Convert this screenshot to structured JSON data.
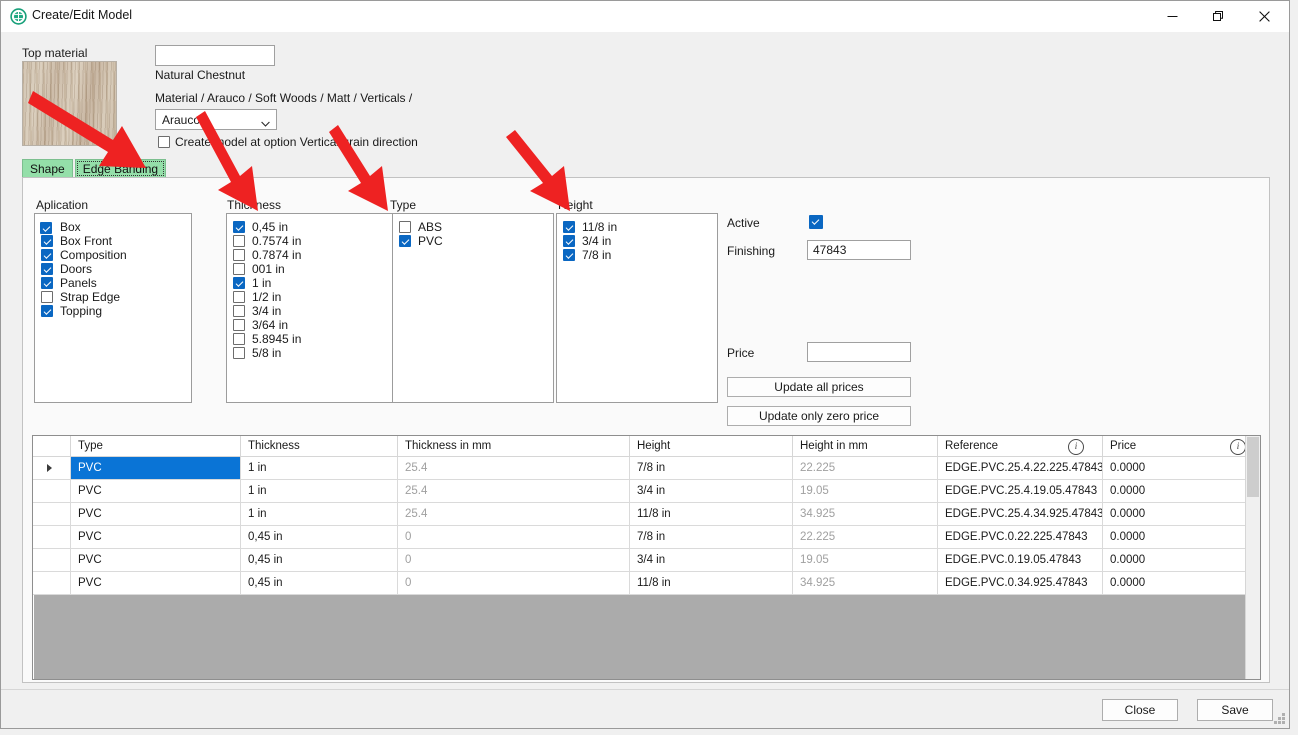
{
  "window": {
    "title": "Create/Edit Model",
    "icon": "globe-icon",
    "minimize": "−",
    "maximize": "❐",
    "close": "✕"
  },
  "top_form": {
    "top_material_label": "Top material",
    "material_name_value": "",
    "material_name_placeholder": "",
    "material_caption": "Natural Chestnut",
    "material_path": "Material  / Arauco / Soft Woods / Matt / Verticals /",
    "brand_combo_value": "Arauco",
    "vertical_grain_checkbox_label": "Create model at option Vertical grain direction",
    "vertical_grain_checked": false
  },
  "tabs": [
    {
      "label": "Shape",
      "active": false,
      "focused": false
    },
    {
      "label": "Edge Banding",
      "active": true,
      "focused": true
    }
  ],
  "lists": {
    "aplication": {
      "title": "Aplication",
      "items": [
        {
          "label": "Box",
          "checked": true
        },
        {
          "label": "Box Front",
          "checked": true
        },
        {
          "label": "Composition",
          "checked": true
        },
        {
          "label": "Doors",
          "checked": true
        },
        {
          "label": "Panels",
          "checked": true
        },
        {
          "label": "Strap Edge",
          "checked": false
        },
        {
          "label": "Topping",
          "checked": true
        }
      ]
    },
    "thickness": {
      "title": "Thickness",
      "items": [
        {
          "label": "0,45 in",
          "checked": true
        },
        {
          "label": "0.7574 in",
          "checked": false
        },
        {
          "label": "0.7874 in",
          "checked": false
        },
        {
          "label": "001 in",
          "checked": false
        },
        {
          "label": "1 in",
          "checked": true
        },
        {
          "label": "1/2 in",
          "checked": false
        },
        {
          "label": "3/4 in",
          "checked": false
        },
        {
          "label": "3/64 in",
          "checked": false
        },
        {
          "label": "5.8945 in",
          "checked": false
        },
        {
          "label": "5/8 in",
          "checked": false
        }
      ]
    },
    "type": {
      "title": "Type",
      "items": [
        {
          "label": "ABS",
          "checked": false
        },
        {
          "label": "PVC",
          "checked": true
        }
      ]
    },
    "height": {
      "title": "Height",
      "items": [
        {
          "label": "11/8 in",
          "checked": true
        },
        {
          "label": "3/4 in",
          "checked": true
        },
        {
          "label": "7/8 in",
          "checked": true
        }
      ]
    }
  },
  "side_panel": {
    "active_label": "Active",
    "active_checked": true,
    "finishing_label": "Finishing",
    "finishing_value": "47843",
    "price_label": "Price",
    "price_value": "",
    "update_all_prices": "Update all prices",
    "update_only_zero_price": "Update only zero price"
  },
  "grid": {
    "columns": [
      {
        "label": "",
        "info": false
      },
      {
        "label": "Type",
        "info": false
      },
      {
        "label": "Thickness",
        "info": false
      },
      {
        "label": "Thickness in mm",
        "info": false
      },
      {
        "label": "Height",
        "info": false
      },
      {
        "label": "Height in mm",
        "info": false
      },
      {
        "label": "Reference",
        "info": true
      },
      {
        "label": "Price",
        "info": true
      }
    ],
    "info_icon": "i",
    "rows": [
      {
        "selected": true,
        "marker": true,
        "type": "PVC",
        "thickness": "1 in",
        "thickness_mm": "25.4",
        "height": "7/8 in",
        "height_mm": "22.225",
        "reference": "EDGE.PVC.25.4.22.225.47843",
        "price": "0.0000"
      },
      {
        "selected": false,
        "marker": false,
        "type": "PVC",
        "thickness": "1 in",
        "thickness_mm": "25.4",
        "height": "3/4 in",
        "height_mm": "19.05",
        "reference": "EDGE.PVC.25.4.19.05.47843",
        "price": "0.0000"
      },
      {
        "selected": false,
        "marker": false,
        "type": "PVC",
        "thickness": "1 in",
        "thickness_mm": "25.4",
        "height": "11/8 in",
        "height_mm": "34.925",
        "reference": "EDGE.PVC.25.4.34.925.47843",
        "price": "0.0000"
      },
      {
        "selected": false,
        "marker": false,
        "type": "PVC",
        "thickness": "0,45 in",
        "thickness_mm": "0",
        "height": "7/8 in",
        "height_mm": "22.225",
        "reference": "EDGE.PVC.0.22.225.47843",
        "price": "0.0000"
      },
      {
        "selected": false,
        "marker": false,
        "type": "PVC",
        "thickness": "0,45 in",
        "thickness_mm": "0",
        "height": "3/4 in",
        "height_mm": "19.05",
        "reference": "EDGE.PVC.0.19.05.47843",
        "price": "0.0000"
      },
      {
        "selected": false,
        "marker": false,
        "type": "PVC",
        "thickness": "0,45 in",
        "thickness_mm": "0",
        "height": "11/8 in",
        "height_mm": "34.925",
        "reference": "EDGE.PVC.0.34.925.47843",
        "price": "0.0000"
      }
    ]
  },
  "footer": {
    "close_button": "Close",
    "save_button": "Save"
  },
  "annotations": {
    "arrow_color": "#ee2222",
    "arrows": [
      {
        "name": "arrow-to-edge-banding-tab"
      },
      {
        "name": "arrow-to-thickness-list"
      },
      {
        "name": "arrow-to-type-list"
      },
      {
        "name": "arrow-to-height-list"
      }
    ]
  },
  "colors": {
    "accent_blue": "#0a67c2",
    "selection_blue": "#0a74d6",
    "tab_green": "#94dfa9",
    "grid_empty_grey": "#ababab"
  }
}
